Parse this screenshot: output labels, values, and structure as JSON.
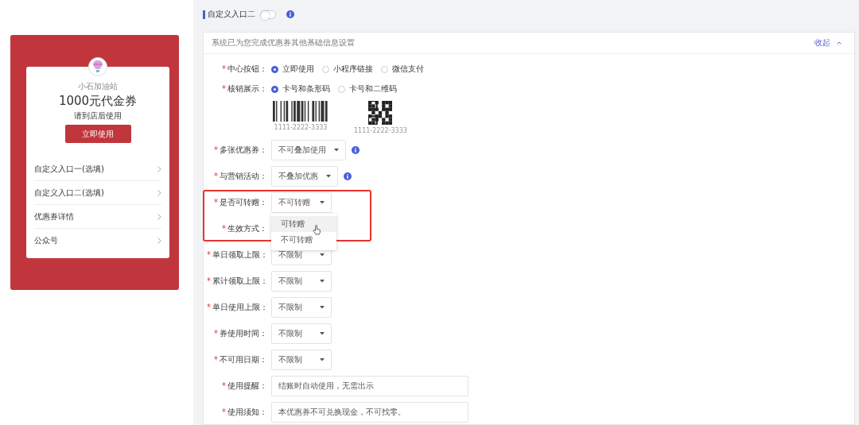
{
  "preview": {
    "shop_name": "小石加油站",
    "title": "1000元代金券",
    "subtitle": "请到店后使用",
    "button": "立即使用",
    "entries": [
      {
        "label": "自定义入口一(选填)"
      },
      {
        "label": "自定义入口二(选填)"
      },
      {
        "label": "优惠券详情"
      },
      {
        "label": "公众号"
      }
    ]
  },
  "section": {
    "title": "自定义入口二",
    "toggle_on": false
  },
  "panel": {
    "notice": "系统已为您完成优惠券其他基础信息设置",
    "collapse_link": "收起"
  },
  "fields": [
    {
      "kind": "radio",
      "marker": "*",
      "label": "中心按钮：",
      "options": [
        {
          "label": "立即使用",
          "selected": true
        },
        {
          "label": "小程序链接",
          "selected": false
        },
        {
          "label": "微信支付",
          "selected": false
        }
      ]
    },
    {
      "kind": "radio",
      "marker": "*",
      "label": "核销展示：",
      "options": [
        {
          "label": "卡号和条形码",
          "selected": true,
          "kind": "barcode",
          "sample": "1111-2222-3333"
        },
        {
          "label": "卡号和二维码",
          "selected": false,
          "kind": "qr",
          "sample": "1111-2222-3333"
        }
      ]
    },
    {
      "kind": "select",
      "marker": "*",
      "label": "多张优惠券：",
      "value": "不可叠加使用",
      "info": true
    },
    {
      "kind": "select",
      "marker": "*",
      "label": "与营销活动：",
      "value": "不叠加优惠",
      "info": true
    },
    {
      "kind": "highlight-group",
      "fields": [
        {
          "kind": "select",
          "marker": "*",
          "label": "是否可转赠：",
          "value": "不可转赠",
          "info": false,
          "open": true,
          "options": [
            {
              "label": "可转赠",
              "hovered": true
            },
            {
              "label": "不可转赠",
              "hovered": false
            }
          ]
        },
        {
          "kind": "select",
          "marker": "*",
          "label": "生效方式："
        }
      ]
    },
    {
      "kind": "select",
      "marker": "*",
      "label": "单日领取上限：",
      "value": "不限制",
      "info": false
    },
    {
      "kind": "select",
      "marker": "*",
      "label": "累计领取上限：",
      "value": "不限制",
      "info": false
    },
    {
      "kind": "select",
      "marker": "*",
      "label": "单日使用上限：",
      "value": "不限制",
      "info": false
    },
    {
      "kind": "select",
      "marker": "*",
      "label": "券使用时间：",
      "value": "不限制",
      "info": false
    },
    {
      "kind": "select",
      "marker": "*",
      "label": "不可用日期：",
      "value": "不限制",
      "info": false
    },
    {
      "kind": "text",
      "marker": "*",
      "label": "使用提醒：",
      "value": "结账时自动使用，无需出示"
    },
    {
      "kind": "text",
      "marker": "*",
      "label": "使用须知：",
      "value": "本优惠券不可兑换现金，不可找零。"
    }
  ]
}
